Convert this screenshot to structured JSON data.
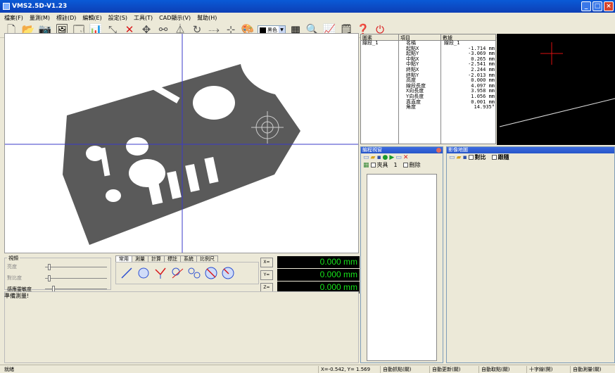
{
  "window": {
    "title": "VMS2.5D-V1.23",
    "minimize": "_",
    "maximize": "□",
    "close": "×"
  },
  "menu": [
    "檔案(F)",
    "量測(M)",
    "標註(D)",
    "編輯(E)",
    "設定(S)",
    "工具(T)",
    "CAD顯示(V)",
    "幫助(H)"
  ],
  "toolbar": {
    "color_label": "黑色"
  },
  "properties": {
    "headers": {
      "element": "圖素",
      "item": "項目",
      "data": "數據"
    },
    "element_name": "線段_1",
    "rows": [
      {
        "item": "名稱",
        "value": "線段_1"
      },
      {
        "item": "起點X",
        "value": "-1.714 mm"
      },
      {
        "item": "起點Y",
        "value": "-3.069 mm"
      },
      {
        "item": "中點X",
        "value": "0.265 mm"
      },
      {
        "item": "中點Y",
        "value": "-2.541 mm"
      },
      {
        "item": "終點X",
        "value": "2.244 mm"
      },
      {
        "item": "終點Y",
        "value": "-2.013 mm"
      },
      {
        "item": "高度",
        "value": "0.000 mm"
      },
      {
        "item": "線段長度",
        "value": "4.097 mm"
      },
      {
        "item": "X向長度",
        "value": "3.958 mm"
      },
      {
        "item": "Y向長度",
        "value": "1.056 mm"
      },
      {
        "item": "真直度",
        "value": "0.001 mm"
      },
      {
        "item": "角度",
        "value": "14.935°"
      }
    ]
  },
  "program_panel": {
    "title": "編程視窗",
    "fixture_label": "夾具",
    "fixture_value": "1",
    "delete_label": "刪除"
  },
  "image_panel": {
    "title": "影像地圖",
    "compare_label": "對比",
    "trace_label": "跟隨"
  },
  "controls": {
    "group_title": "視頻",
    "brightness": "亮度",
    "contrast": "對比度",
    "sensitivity": "感應靈敏度",
    "tabs": [
      "常用",
      "測量",
      "計算",
      "標註",
      "系統",
      "比例尺"
    ],
    "coords": [
      {
        "axis": "X=",
        "value": "0.000 mm"
      },
      {
        "axis": "Y=",
        "value": "0.000 mm"
      },
      {
        "axis": "Z=",
        "value": "0.000 mm"
      }
    ]
  },
  "message": "準備測量!",
  "statusbar": {
    "ready": "就緒",
    "cursor": "X=-0.542, Y= 1.569",
    "items": [
      "自動抓點(關)",
      "自動更新(關)",
      "自動取點(關)",
      "十字線(開)",
      "自動測量(關)"
    ]
  }
}
